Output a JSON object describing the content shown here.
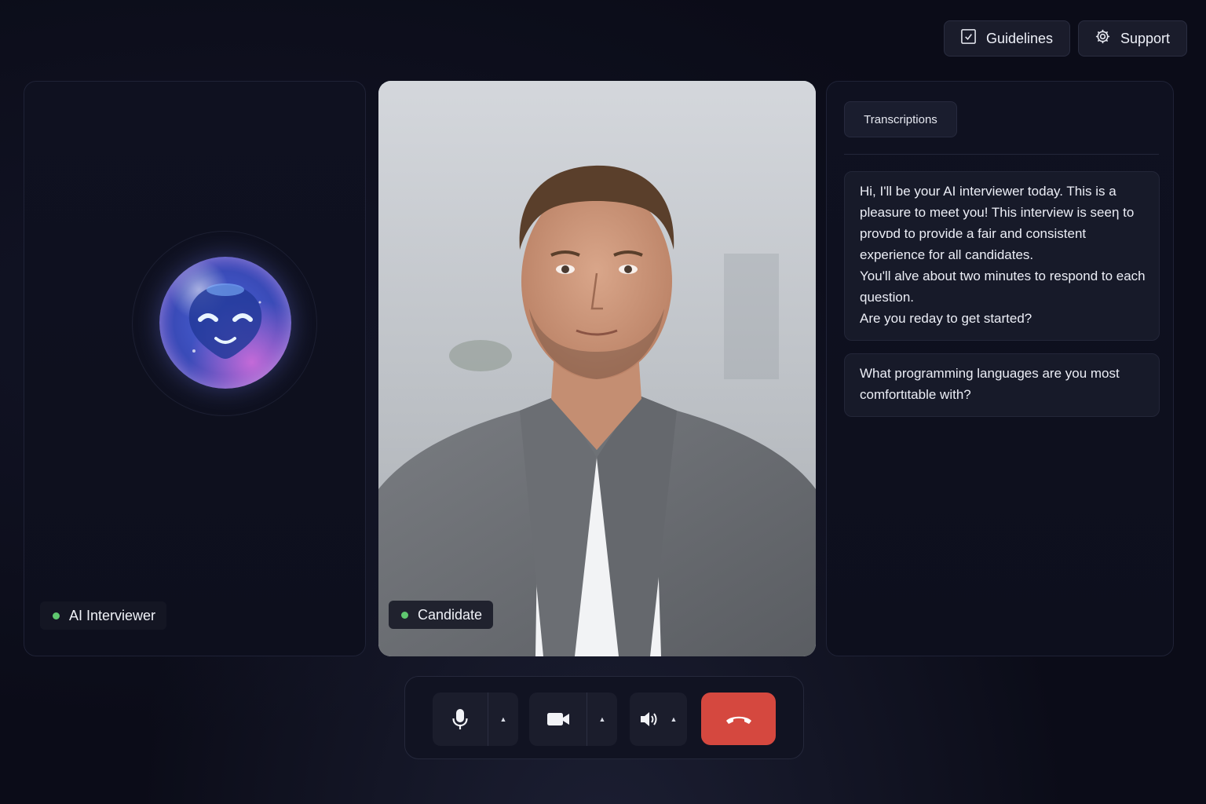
{
  "header": {
    "guidelines_label": "Guidelines",
    "support_label": "Support"
  },
  "ai_panel": {
    "name": "AI Interviewer",
    "status_color": "#5fc76f"
  },
  "candidate_panel": {
    "name": "Candidate",
    "status_color": "#5fc76f"
  },
  "transcript": {
    "tab_label": "Transcriptions",
    "messages": [
      {
        "lines": [
          "Hi, I'll be your AI interviewer today.  This is a pleasure to meet you! This interview is seeη to provᴅd to provide a fair and consistent experience for all candidates.",
          "You'll alve about two minutes to respond to each question.",
          "Are you reday to get started?"
        ]
      },
      {
        "lines": [
          "What programming languages are you most comfortιtable with?"
        ]
      }
    ]
  },
  "controls": {
    "mic_icon": "microphone-icon",
    "camera_icon": "video-camera-icon",
    "speaker_icon": "speaker-icon",
    "hangup_icon": "phone-hangup-icon",
    "hangup_color": "#d5483f"
  }
}
